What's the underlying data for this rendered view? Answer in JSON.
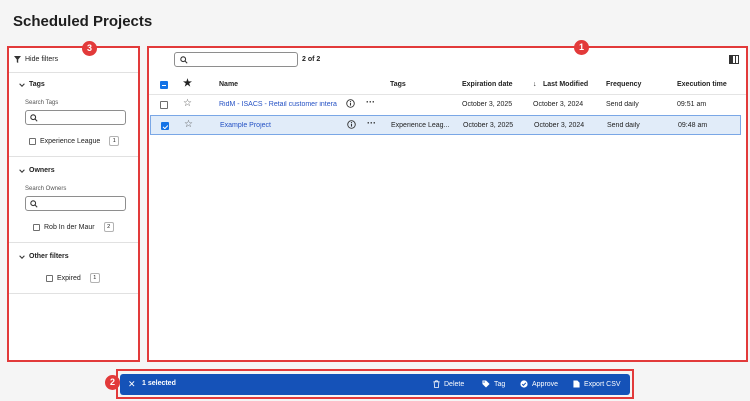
{
  "page": {
    "title": "Scheduled Projects"
  },
  "callouts": {
    "table": "1",
    "action_bar": "2",
    "filters": "3"
  },
  "filters": {
    "hide_label": "Hide filters",
    "tags": {
      "title": "Tags",
      "search_label": "Search Tags",
      "items": [
        {
          "label": "Experience League",
          "count": "1"
        }
      ]
    },
    "owners": {
      "title": "Owners",
      "search_label": "Search Owners",
      "items": [
        {
          "label": "Rob In der Maur",
          "count": "2"
        }
      ]
    },
    "other": {
      "title": "Other filters",
      "items": [
        {
          "label": "Expired",
          "count": "1"
        }
      ]
    }
  },
  "table": {
    "result_count": "2 of 2",
    "columns": [
      "Name",
      "Tags",
      "Expiration date",
      "Last Modified",
      "Frequency",
      "Execution time"
    ],
    "rows": [
      {
        "name": "RidM - ISACS - Retail customer interacti",
        "tags": "",
        "expiration": "October 3, 2025",
        "modified": "October 3, 2024",
        "frequency": "Send daily",
        "time": "09:51 am",
        "selected": false
      },
      {
        "name": "Example Project",
        "tags": "Experience Leag...",
        "expiration": "October 3, 2025",
        "modified": "October 3, 2024",
        "frequency": "Send daily",
        "time": "09:48 am",
        "selected": true
      }
    ]
  },
  "action_bar": {
    "selected_label": "1 selected",
    "delete": "Delete",
    "tag": "Tag",
    "approve": "Approve",
    "export": "Export CSV"
  },
  "colors": {
    "accent": "#1473e6",
    "action_bar": "#1552b8",
    "annotation": "#e23a3a",
    "link": "#2451c4"
  }
}
